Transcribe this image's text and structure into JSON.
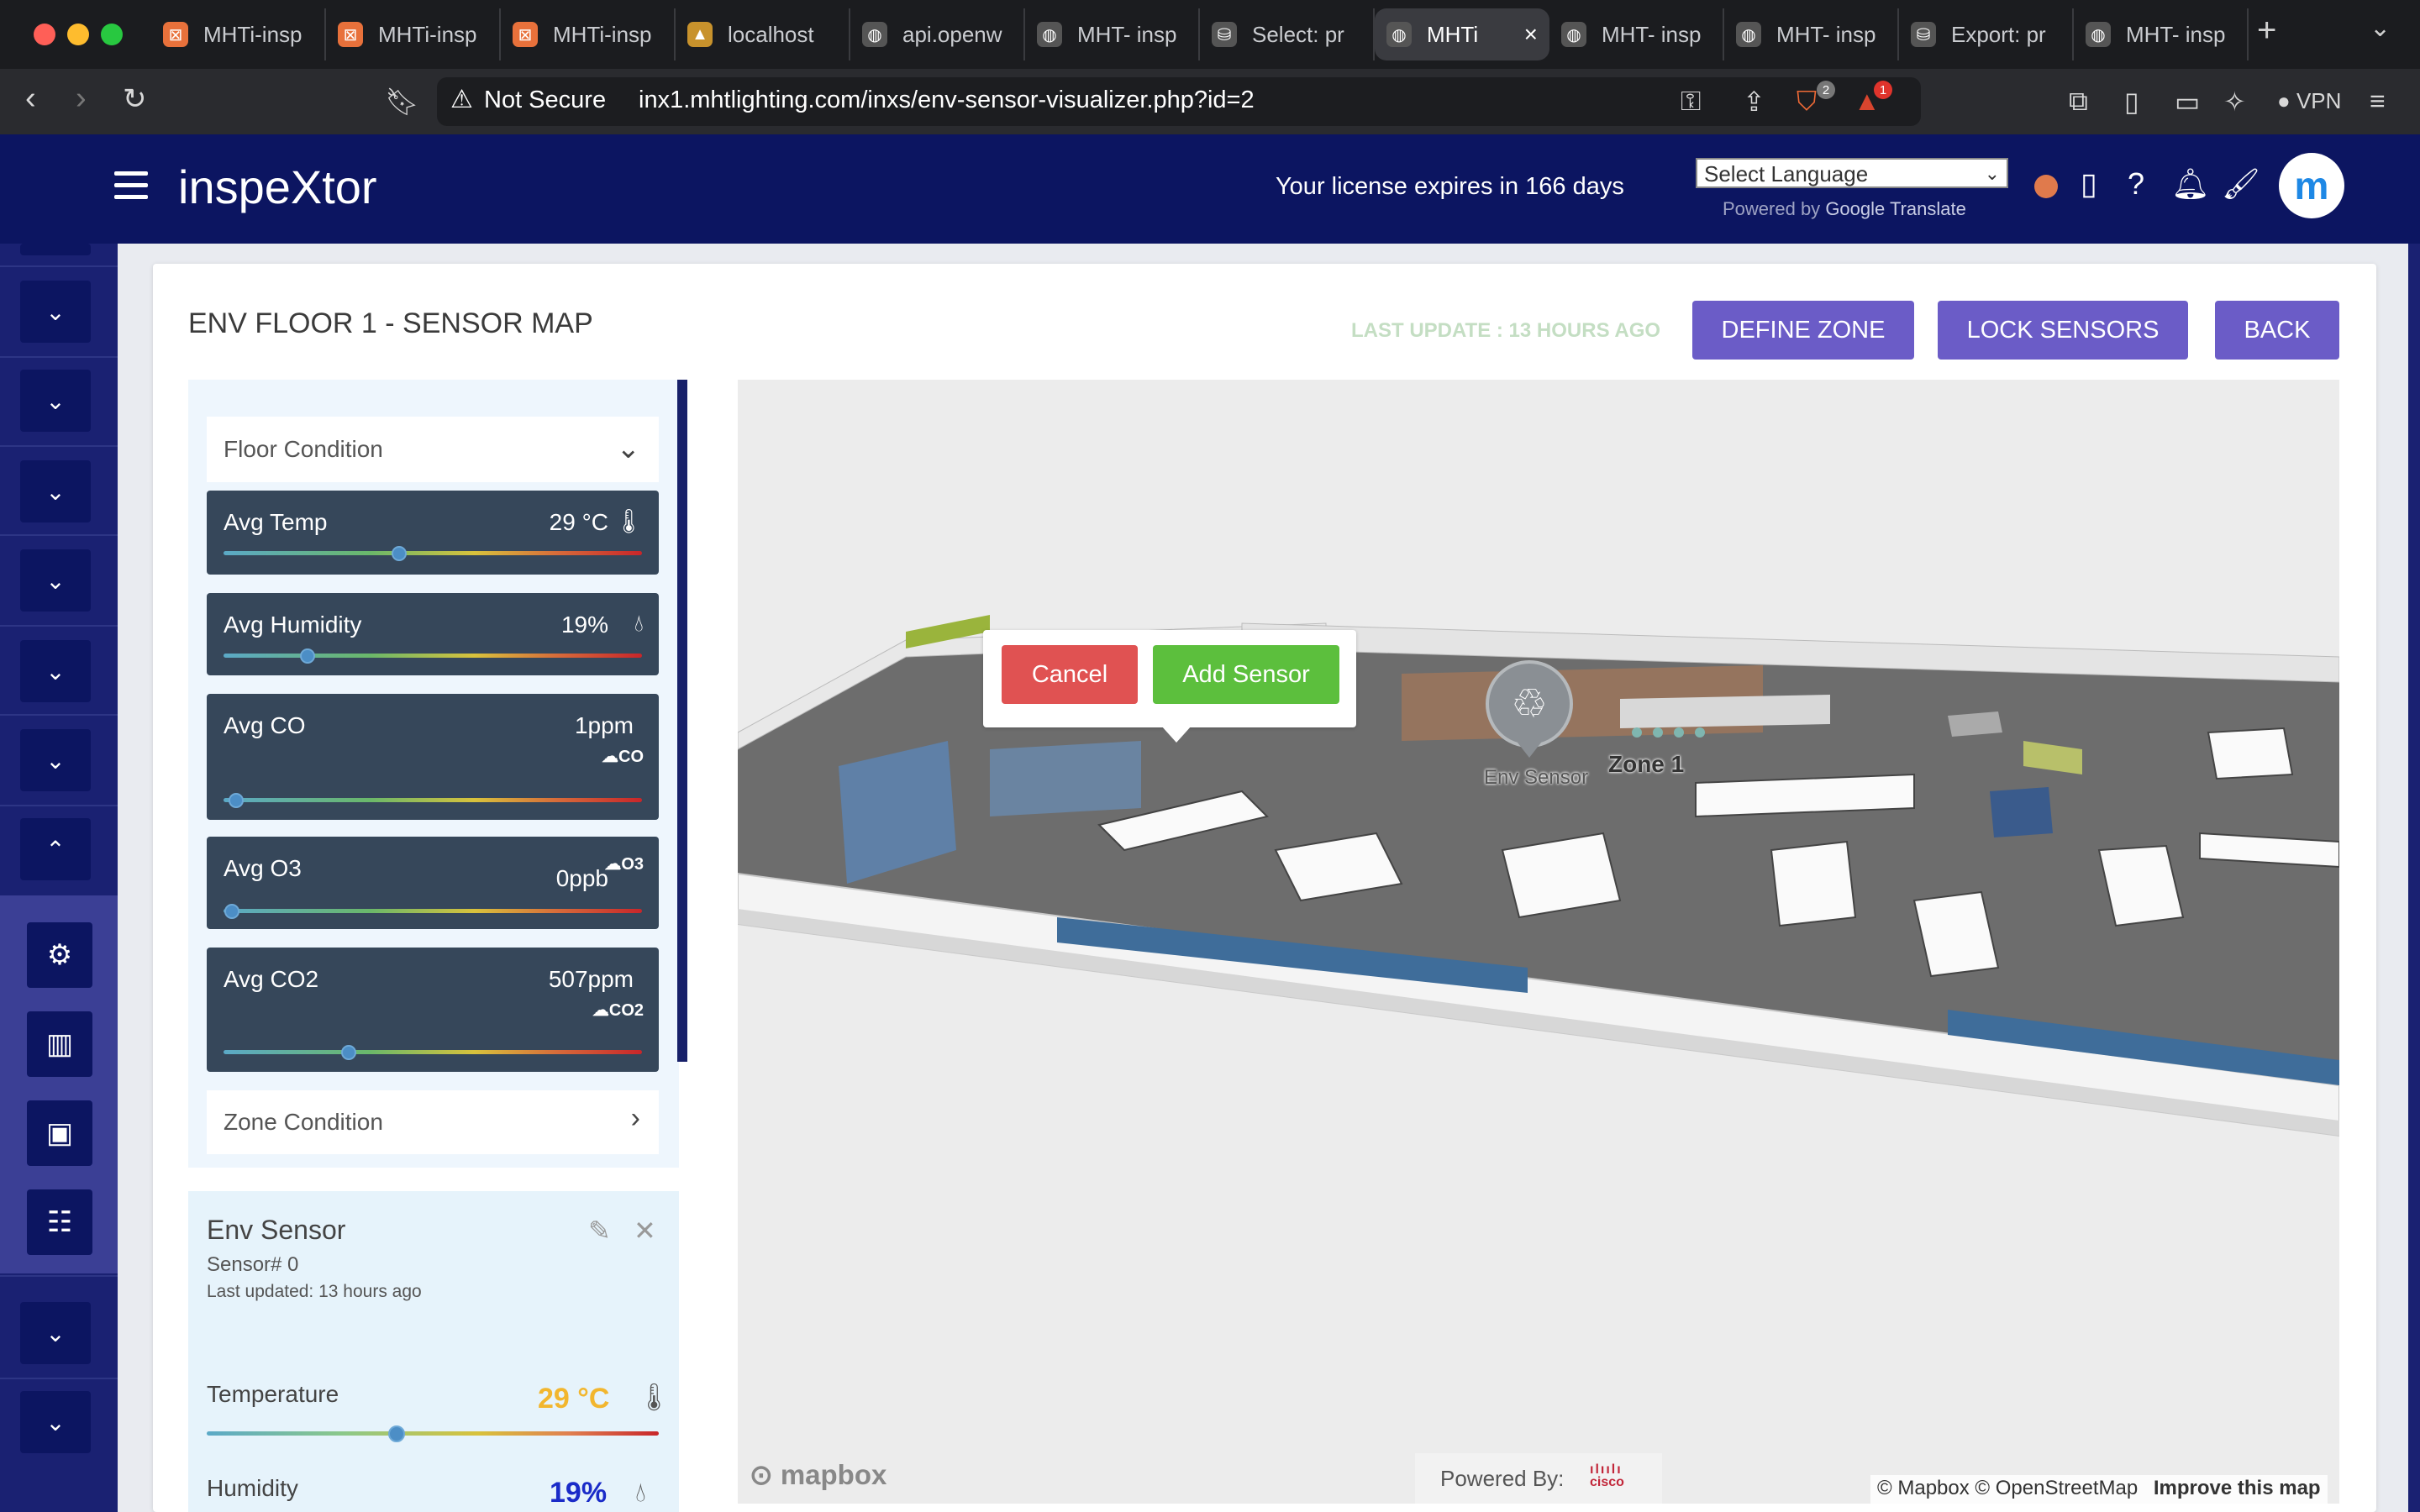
{
  "browser": {
    "tabs": [
      {
        "title": "MHTi-insp",
        "icon": "mht-icon",
        "color": "#e8713b"
      },
      {
        "title": "MHTi-insp",
        "icon": "mht-icon",
        "color": "#e8713b"
      },
      {
        "title": "MHTi-insp",
        "icon": "mht-icon",
        "color": "#e8713b"
      },
      {
        "title": "localhost",
        "icon": "localhost-icon",
        "color": "#c8922c"
      },
      {
        "title": "api.openw",
        "icon": "globe-icon",
        "color": "#555"
      },
      {
        "title": "MHT- insp",
        "icon": "globe-icon",
        "color": "#555"
      },
      {
        "title": "Select: pr",
        "icon": "db-icon",
        "color": "#555"
      },
      {
        "title": "MHTi",
        "icon": "globe-icon",
        "color": "#555",
        "active": true
      },
      {
        "title": "MHT- insp",
        "icon": "globe-icon",
        "color": "#555"
      },
      {
        "title": "MHT- insp",
        "icon": "globe-icon",
        "color": "#555"
      },
      {
        "title": "Export: pr",
        "icon": "db-icon",
        "color": "#555"
      },
      {
        "title": "MHT- insp",
        "icon": "globe-icon",
        "color": "#555"
      }
    ],
    "security": "Not Secure",
    "url": "inx1.mhtlighting.com/inxs/env-sensor-visualizer.php?id=2",
    "brave_badge": "2",
    "alert_badge": "1",
    "vpn_label": "VPN"
  },
  "header": {
    "brand": "inspeXtor",
    "license": "Your license expires in 166 days",
    "language_select": "Select Language",
    "powered_by": "Powered by",
    "google": "Google",
    "translate": "Translate"
  },
  "page": {
    "title": "ENV FLOOR 1 - SENSOR MAP",
    "last_update": "LAST UPDATE : 13 HOURS AGO",
    "buttons": {
      "define_zone": "DEFINE ZONE",
      "lock_sensors": "LOCK SENSORS",
      "back": "BACK"
    }
  },
  "floor_condition": {
    "header": "Floor Condition",
    "metrics": [
      {
        "label": "Avg Temp",
        "value": "29 °C",
        "icon": "thermometer-icon",
        "level": 0.42
      },
      {
        "label": "Avg Humidity",
        "value": "19%",
        "icon": "droplet-icon",
        "level": 0.2
      },
      {
        "label": "Avg CO",
        "value": "1ppm",
        "icon": "co-cloud-icon",
        "level": 0.03
      },
      {
        "label": "Avg O3",
        "value": "0ppb",
        "icon": "o3-cloud-icon",
        "level": 0.02
      },
      {
        "label": "Avg CO2",
        "value": "507ppm",
        "icon": "co2-cloud-icon",
        "level": 0.3
      }
    ],
    "zone_header": "Zone Condition"
  },
  "sensor": {
    "name": "Env Sensor",
    "number": "Sensor# 0",
    "updated": "Last updated: 13 hours ago",
    "temperature_label": "Temperature",
    "temperature_value": "29 °C",
    "temperature_color": "#f2b62e",
    "temperature_level": 0.42,
    "humidity_label": "Humidity",
    "humidity_value": "19%",
    "humidity_color": "#1a2bc8"
  },
  "map": {
    "cancel": "Cancel",
    "add_sensor": "Add Sensor",
    "sensor_label": "Env Sensor",
    "zone_label": "Zone 1",
    "mapbox": "mapbox",
    "powered_by": "Powered By:",
    "cisco": "cisco",
    "attribution": "© Mapbox © OpenStreetMap",
    "improve": "Improve this map"
  },
  "colors": {
    "header": "#0c1561",
    "purple_button": "#6b5cc7",
    "cancel": "#e05252",
    "add": "#5cbf3d"
  }
}
